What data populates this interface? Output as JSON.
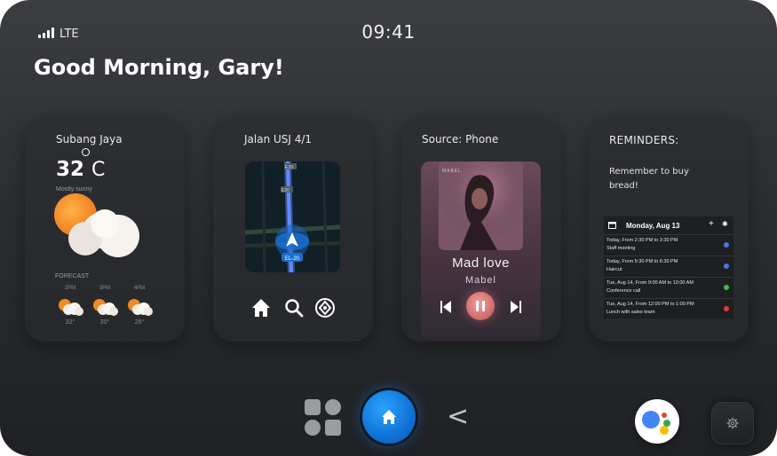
{
  "status_bar": {
    "network": "LTE",
    "time": "09:41"
  },
  "greeting": "Good Morning, Gary!",
  "weather": {
    "location": "Subang Jaya",
    "temperature": "32",
    "unit": "C",
    "condition": "Mostly sunny",
    "forecast_label": "FORECAST",
    "forecast": [
      {
        "hour": "2PM",
        "temp": "32°"
      },
      {
        "hour": "3PM",
        "temp": "30°"
      },
      {
        "hour": "4PM",
        "temp": "28°"
      }
    ]
  },
  "navigation": {
    "street": "Jalan USJ 4/1",
    "road_label": "EL-20",
    "map_labels": [
      "E20",
      "E20"
    ]
  },
  "music": {
    "source": "Source: Phone",
    "album_text": "MABEL",
    "song": "Mad love",
    "artist": "Mabel"
  },
  "reminders": {
    "title": "REMINDERS:",
    "text": "Remember to buy bread!",
    "calendar": {
      "date": "Monday, Aug 13",
      "events": [
        {
          "line1": "Today, From 2:30 PM to 3:30 PM",
          "line2": "Staff meeting",
          "color": "#4a78e0"
        },
        {
          "line1": "Today, From 5:30 PM to 6:30 PM",
          "line2": "Haircut",
          "color": "#4a78e0"
        },
        {
          "line1": "Tue, Aug 14, From 9:00 AM to 10:00 AM",
          "line2": "Conference call",
          "color": "#3cba54"
        },
        {
          "line1": "Tue, Aug 14, From 12:00 PM to 1:00 PM",
          "line2": "Lunch with sales team",
          "color": "#e53935"
        }
      ]
    }
  },
  "dock": {
    "apps_icon": "apps-grid-icon",
    "home_icon": "home-icon",
    "back_label": "<",
    "assistant_icon": "google-assistant-icon",
    "settings_icon": "gear-icon"
  },
  "colors": {
    "accent": "#1a8cff",
    "background": "#2b2d31"
  }
}
